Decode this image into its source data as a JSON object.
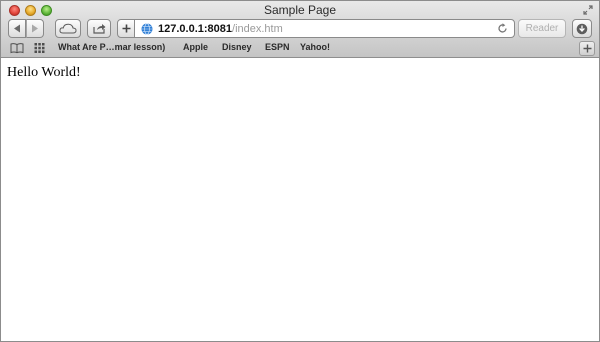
{
  "window": {
    "title": "Sample Page"
  },
  "toolbar": {
    "address": {
      "host": "127.0.0.1:8081",
      "path": "/index.htm"
    },
    "reader_label": "Reader"
  },
  "bookmarks": {
    "items": [
      {
        "label": "What Are P…mar lesson)"
      },
      {
        "label": "Apple"
      },
      {
        "label": "Disney"
      },
      {
        "label": "ESPN"
      },
      {
        "label": "Yahoo!"
      }
    ]
  },
  "page": {
    "text": "Hello World!"
  },
  "icons": {
    "back": "back-arrow-icon",
    "forward": "forward-arrow-icon",
    "icloud": "cloud-icon",
    "share": "share-icon",
    "add": "plus-icon",
    "globe": "globe-icon",
    "reload": "reload-icon",
    "download": "download-icon",
    "reading_list": "book-icon",
    "top_sites": "grid-icon",
    "new_tab": "plus-icon",
    "fullscreen": "fullscreen-icon"
  },
  "colors": {
    "close": "#e0443a",
    "minimize": "#e6a92a",
    "maximize": "#5fb63a",
    "globe": "#2f7fd6"
  }
}
